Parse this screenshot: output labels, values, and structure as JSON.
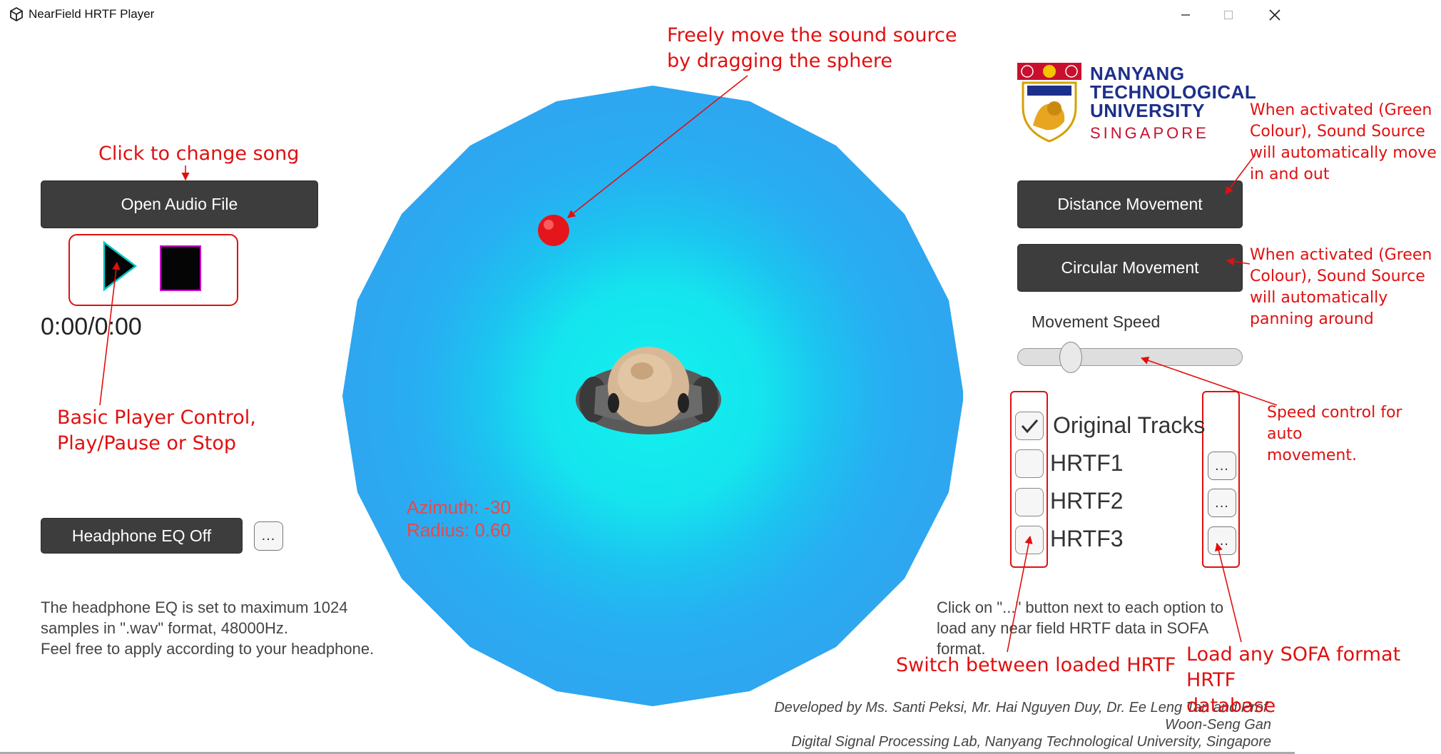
{
  "window": {
    "title": "NearField HRTF Player",
    "minimize_glyph": "—",
    "maximize_glyph": "☐",
    "close_glyph": "✕"
  },
  "player": {
    "open_audio_label": "Open Audio File",
    "time_display": "0:00/0:00",
    "headphone_eq_label": "Headphone EQ Off",
    "eq_more_label": "...",
    "eq_note": [
      "The headphone EQ is set to maximum 1024",
      "samples in \".wav\" format, 48000Hz.",
      "Feel free to apply according to your headphone."
    ]
  },
  "scene": {
    "azimuth_text": "Azimuth: -30",
    "radius_text": "Radius: 0.60",
    "colors": {
      "outer": "#2ea6f0",
      "inner": "#18e6ee",
      "source": "#e4161b"
    }
  },
  "controls": {
    "distance_movement_label": "Distance Movement",
    "circular_movement_label": "Circular Movement",
    "movement_speed_label": "Movement Speed",
    "movement_speed_value": 0.05,
    "tracks": [
      {
        "label": "Original Tracks",
        "checked": true,
        "has_more": false
      },
      {
        "label": "HRTF1",
        "checked": false,
        "has_more": true
      },
      {
        "label": "HRTF2",
        "checked": false,
        "has_more": true
      },
      {
        "label": "HRTF3",
        "checked": false,
        "has_more": true
      }
    ],
    "more_label": "...",
    "sofa_note": [
      "Click on \"...\" button next to each option to",
      "load any near field HRTF data in SOFA",
      "format."
    ]
  },
  "logo": {
    "line1": "NANYANG",
    "line2": "TECHNOLOGICAL",
    "line3": "UNIVERSITY",
    "line4": "SINGAPORE"
  },
  "credits": {
    "line1": "Developed by  Ms. Santi Peksi, Mr. Hai Nguyen Duy, Dr. Ee Leng Tan and  Prof.",
    "line2": "Woon-Seng Gan",
    "line3": "Digital Signal Processing Lab, Nanyang Technological University, Singapore"
  },
  "annotations": {
    "change_song": "Click to change song",
    "move_source_1": "Freely move the sound source",
    "move_source_2": "by dragging the  sphere",
    "player_control_1": "Basic Player Control,",
    "player_control_2": "Play/Pause or Stop",
    "distance_1": "When activated (Green",
    "distance_2": "Colour), Sound Source",
    "distance_3": "will automatically move",
    "distance_4": "in and out",
    "circular_1": "When activated (Green",
    "circular_2": "Colour), Sound Source",
    "circular_3": "will automatically",
    "circular_4": "panning around",
    "speed_1": "Speed control for auto",
    "speed_2": "movement.",
    "switch_hrtf": "Switch between loaded HRTF",
    "load_sofa_1": "Load any SOFA format HRTF",
    "load_sofa_2": "database"
  }
}
